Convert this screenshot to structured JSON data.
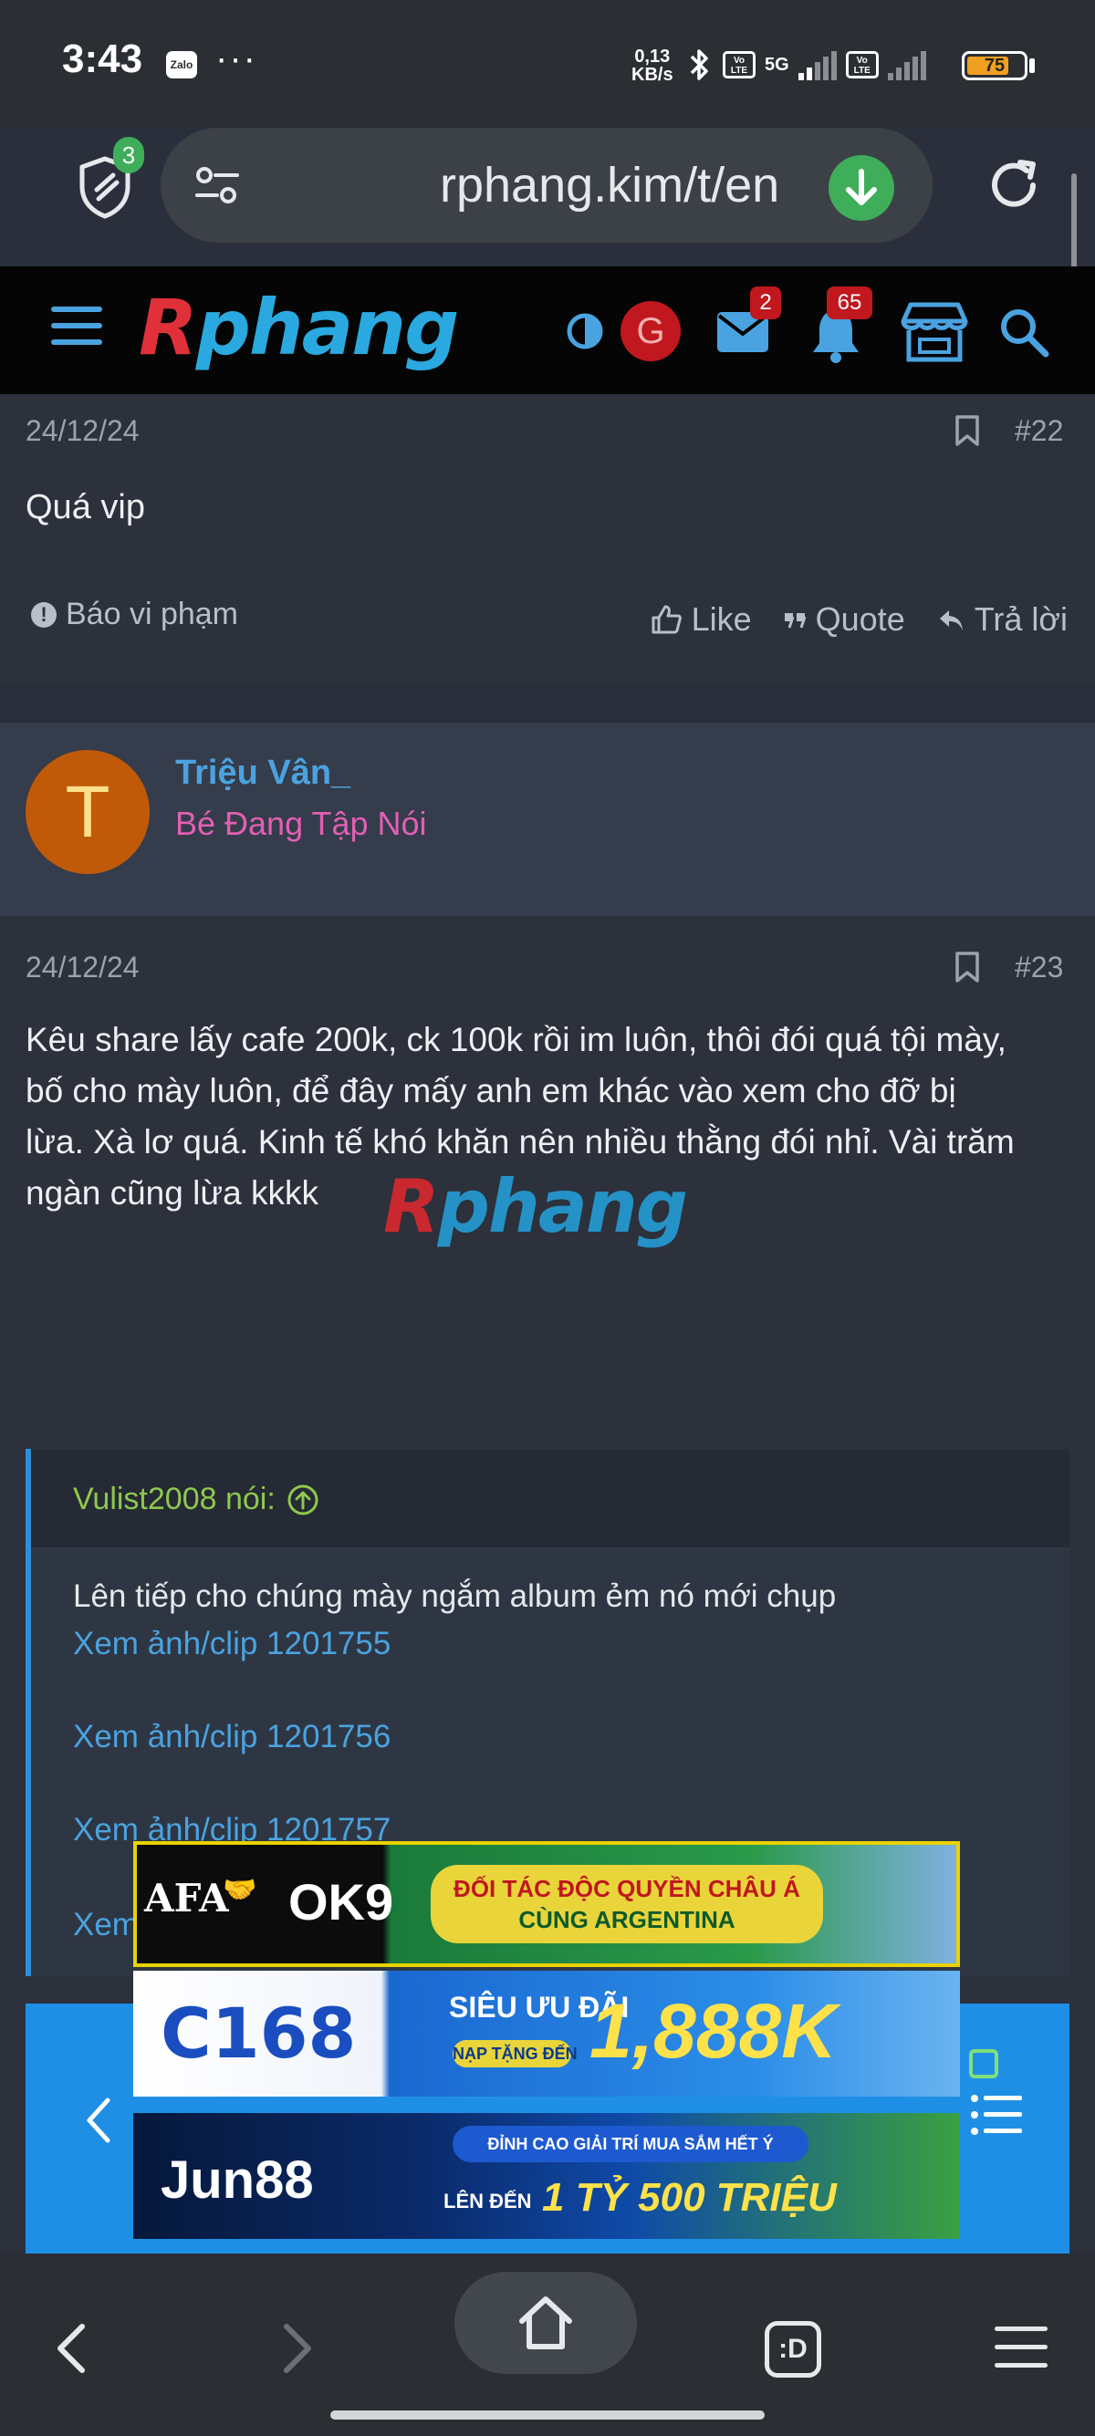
{
  "status_bar": {
    "time": "3:43",
    "zalo_label": "Zalo",
    "more": "···",
    "net_speed_value": "0,13",
    "net_speed_unit": "KB/s",
    "volte1": "Vo LTE",
    "network": "5G",
    "volte2": "Vo LTE",
    "battery_level": 75,
    "battery_text": "75",
    "battery_color": "#f0a020"
  },
  "browser": {
    "shield_count": "3",
    "url": "rphang.kim/t/en"
  },
  "site_header": {
    "logo_r": "R",
    "logo_rest": "phang",
    "avatar_letter": "G",
    "mail_badge": "2",
    "bell_badge": "65"
  },
  "post1": {
    "date": "24/12/24",
    "number": "#22",
    "body": "Quá vip",
    "report_label": "Báo vi phạm",
    "like_label": "Like",
    "quote_label": "Quote",
    "reply_label": "Trả lời"
  },
  "user": {
    "avatar_letter": "T",
    "name": "Triệu Vân_",
    "title": "Bé Đang Tập Nói"
  },
  "post2": {
    "date": "24/12/24",
    "number": "#23",
    "body_lines": [
      "Kêu share lấy cafe 200k, ck 100k rồi im luôn, thôi đói quá tội mày,",
      "bố cho mày luôn, để đây mấy anh em khác vào xem cho đỡ bị",
      "lừa. Xà lơ quá. Kinh tế khó khăn nên nhiều thằng đói nhỉ. Vài trăm",
      "ngàn cũng lừa kkkk"
    ],
    "watermark_r": "R",
    "watermark_rest": "phang",
    "quote": {
      "author": "Vulist2008 nói:",
      "text": "Lên tiếp cho chúng mày ngắm album ẻm nó mới chụp",
      "links": [
        "Xem ảnh/clip 1201755",
        "Xem ảnh/clip 1201756",
        "Xem ảnh/clip 1201757",
        "Xem"
      ]
    }
  },
  "ads": {
    "ad1": {
      "brand": "OK9",
      "left_badge": "AFA",
      "slogan_line1": "ĐỐI TÁC ĐỘC QUYỀN CHÂU Á",
      "slogan_line2": "CÙNG ARGENTINA"
    },
    "ad2": {
      "brand": "C168",
      "promo_top": "SIÊU ƯU ĐÃI",
      "promo_sub": "NẠP TẶNG ĐẾN",
      "promo_amount": "1,888K"
    },
    "ad3": {
      "brand": "Jun88",
      "promo_top": "ĐỈNH CAO GIẢI TRÍ MUA SẮM HẾT Ý",
      "promo_sub": "LÊN ĐẾN",
      "promo_amount": "1 TỶ 500 TRIỆU"
    }
  },
  "bottom_nav": {
    "tabs_label": ":D"
  },
  "colors": {
    "accent_blue": "#4aa3e0",
    "user_title_pink": "#e25fb4",
    "quote_author_green": "#8ec84e",
    "badge_red": "#c0181e"
  },
  "icons": [
    "shield-icon",
    "tune-icon",
    "download-icon",
    "reload-icon",
    "hamburger-icon",
    "contrast-icon",
    "mail-icon",
    "bell-icon",
    "store-icon",
    "search-icon",
    "bookmark-icon",
    "report-icon",
    "like-icon",
    "quote-icon",
    "reply-icon",
    "arrow-up-circle-icon",
    "chevron-left-icon",
    "list-icon",
    "back-icon",
    "forward-icon",
    "home-icon",
    "tabs-icon",
    "menu-icon"
  ]
}
